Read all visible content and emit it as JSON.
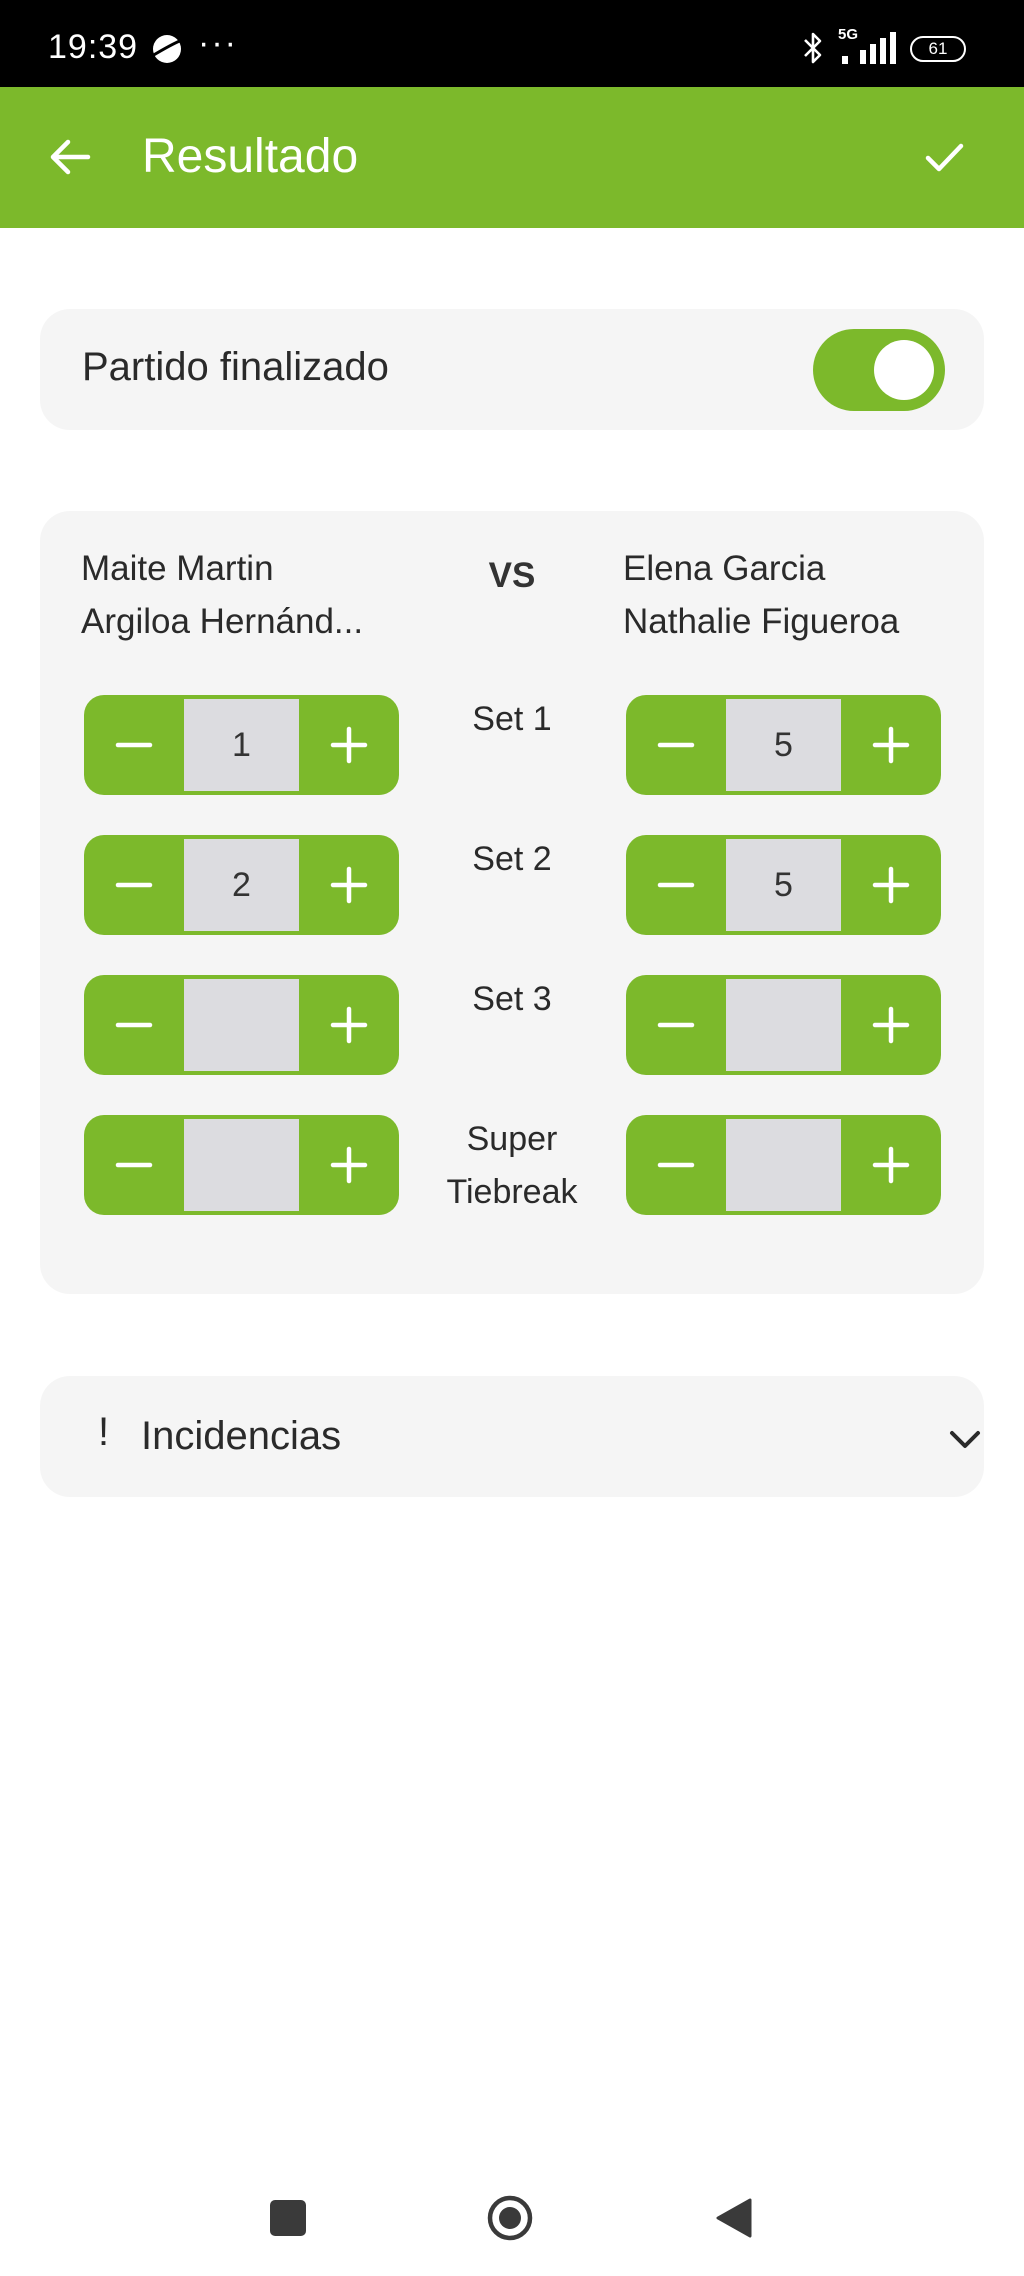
{
  "status_bar": {
    "time": "19:39",
    "more": "···",
    "network": "5G",
    "battery": "61"
  },
  "app_bar": {
    "title": "Resultado",
    "back_icon": "arrow-left-icon",
    "confirm_icon": "check-icon",
    "color": "#7cb92b"
  },
  "finalizado": {
    "label": "Partido finalizado",
    "checked": true
  },
  "match": {
    "vs_label": "VS",
    "left_players": [
      "Maite Martin",
      "Argiloa Hernánd..."
    ],
    "right_players": [
      "Elena Garcia",
      "Nathalie Figueroa"
    ],
    "sets": [
      {
        "label": "Set 1",
        "left": "1",
        "right": "5"
      },
      {
        "label": "Set 2",
        "left": "2",
        "right": "5"
      },
      {
        "label": "Set 3",
        "left": "",
        "right": ""
      },
      {
        "label_line1": "Super",
        "label_line2": "Tiebreak",
        "left": "",
        "right": ""
      }
    ]
  },
  "incidencias": {
    "mark": "!",
    "label": "Incidencias",
    "icon": "chevron-down-icon"
  },
  "nav_bar": {
    "recents_icon": "square-icon",
    "home_icon": "circle-icon",
    "back_icon": "triangle-back-icon"
  }
}
